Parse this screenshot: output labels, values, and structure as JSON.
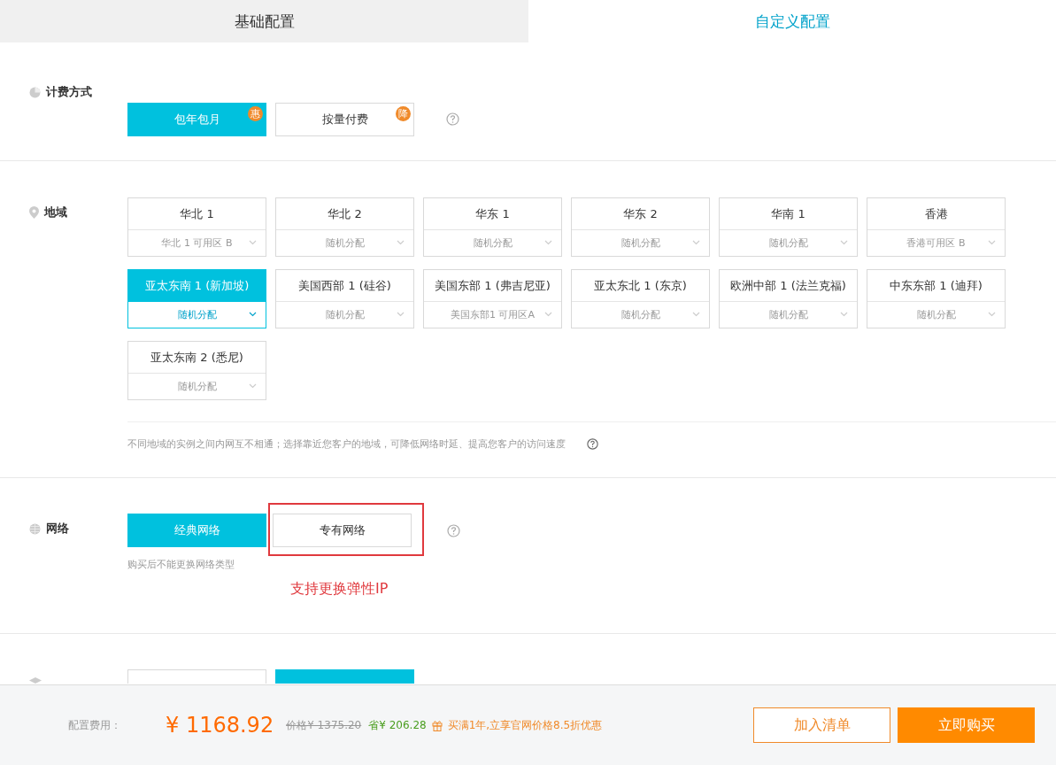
{
  "tabs": [
    {
      "label": "基础配置",
      "selected": false
    },
    {
      "label": "自定义配置",
      "selected": true
    }
  ],
  "billing": {
    "label": "计费方式",
    "options": [
      {
        "label": "包年包月",
        "badge": "惠",
        "selected": true
      },
      {
        "label": "按量付费",
        "badge": "降",
        "selected": false
      }
    ]
  },
  "region": {
    "label": "地域",
    "options": [
      {
        "name": "华北 1",
        "zone": "华北 1 可用区 B",
        "selected": false
      },
      {
        "name": "华北 2",
        "zone": "随机分配",
        "selected": false
      },
      {
        "name": "华东 1",
        "zone": "随机分配",
        "selected": false
      },
      {
        "name": "华东 2",
        "zone": "随机分配",
        "selected": false
      },
      {
        "name": "华南 1",
        "zone": "随机分配",
        "selected": false
      },
      {
        "name": "香港",
        "zone": "香港可用区 B",
        "selected": false
      },
      {
        "name": "亚太东南 1 (新加坡)",
        "zone": "随机分配",
        "selected": true
      },
      {
        "name": "美国西部 1 (硅谷)",
        "zone": "随机分配",
        "selected": false
      },
      {
        "name": "美国东部 1 (弗吉尼亚)",
        "zone": "美国东部1 可用区A",
        "selected": false
      },
      {
        "name": "亚太东北 1 (东京)",
        "zone": "随机分配",
        "selected": false
      },
      {
        "name": "欧洲中部 1 (法兰克福)",
        "zone": "随机分配",
        "selected": false
      },
      {
        "name": "中东东部 1 (迪拜)",
        "zone": "随机分配",
        "selected": false
      },
      {
        "name": "亚太东南 2 (悉尼)",
        "zone": "随机分配",
        "selected": false
      }
    ],
    "note": "不同地域的实例之间内网互不相通；选择靠近您客户的地域，可降低网络时延、提高您客户的访问速度"
  },
  "network": {
    "label": "网络",
    "options": [
      {
        "label": "经典网络",
        "selected": true,
        "highlighted": false
      },
      {
        "label": "专有网络",
        "selected": false,
        "highlighted": true
      }
    ],
    "note": "购买后不能更换网络类型",
    "annotation": "支持更换弹性IP"
  },
  "instance": {
    "options": [
      {
        "selected": false
      },
      {
        "selected": true
      }
    ]
  },
  "footer": {
    "label": "配置费用：",
    "price": "¥ 1168.92",
    "original_price": "价格¥ 1375.20",
    "saving": "省¥ 206.28",
    "promo": "买满1年,立享官网价格8.5折优惠",
    "buttons": [
      {
        "label": "加入清单",
        "kind": "outline"
      },
      {
        "label": "立即购买",
        "kind": "primary"
      }
    ]
  }
}
